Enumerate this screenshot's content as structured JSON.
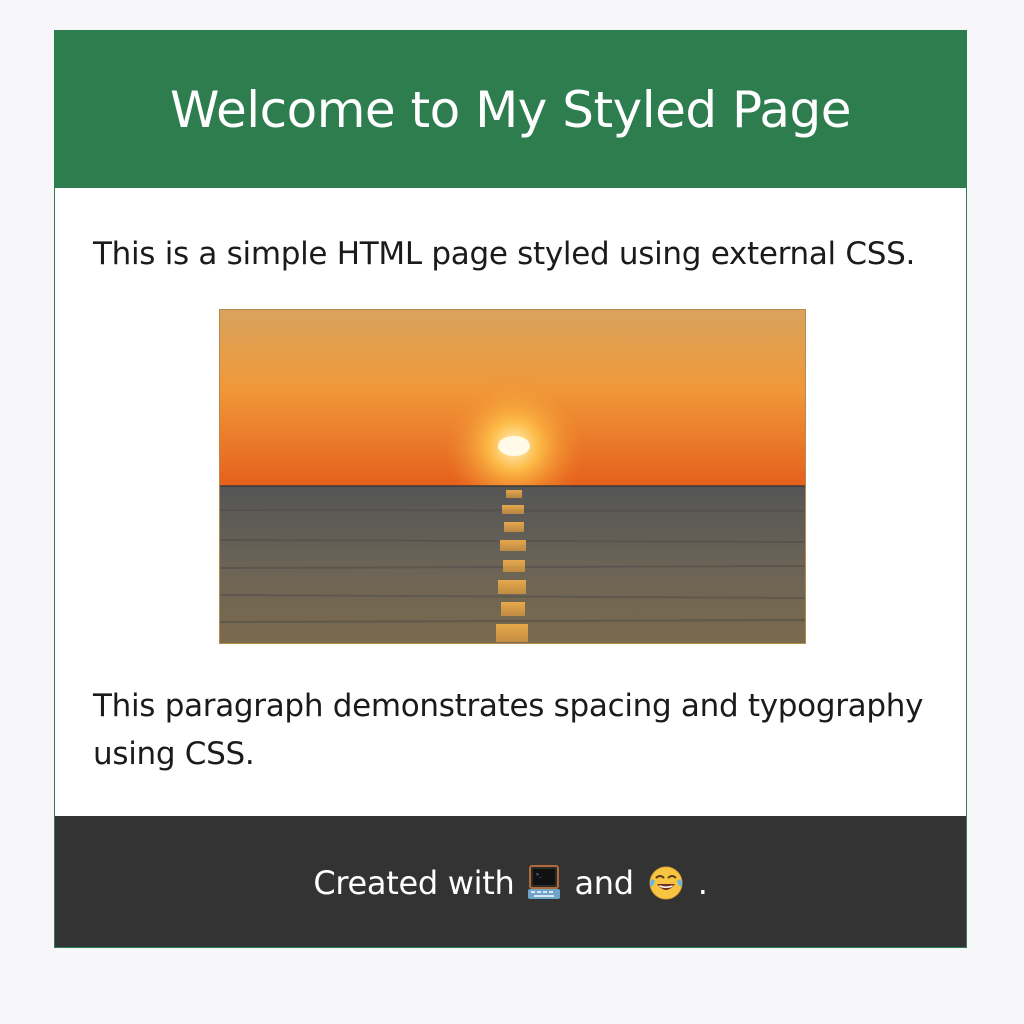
{
  "header": {
    "title": "Welcome to My Styled Page"
  },
  "content": {
    "intro": "This is a simple HTML page styled using external CSS.",
    "outro": "This paragraph demonstrates spacing and typography using CSS."
  },
  "footer": {
    "prefix": "Created with",
    "middle": "and",
    "suffix": ".",
    "icons": [
      "computer-icon",
      "laughing-emoji-icon"
    ]
  },
  "colors": {
    "header_bg": "#2e7d4f",
    "footer_bg": "#333333",
    "page_bg": "#f7f7f9",
    "text": "#1b1b1b"
  }
}
